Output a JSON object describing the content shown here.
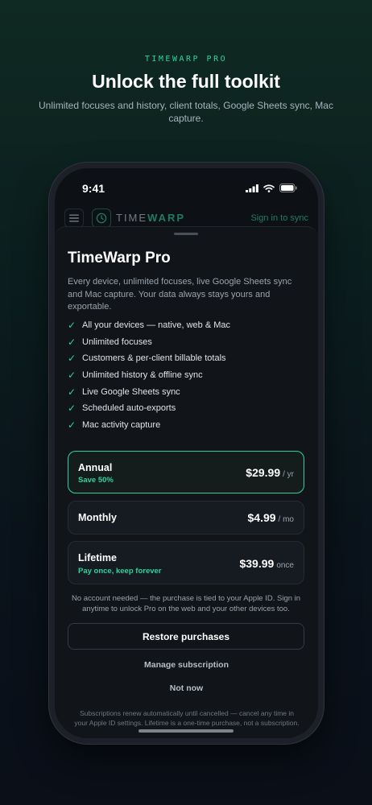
{
  "promo": {
    "eyebrow": "TIMEWARP PRO",
    "title": "Unlock the full toolkit",
    "subtitle": "Unlimited focuses and history, client totals, Google Sheets sync, Mac capture."
  },
  "status_bar": {
    "time": "9:41",
    "icons": [
      "signal-icon",
      "wifi-icon",
      "battery-icon"
    ]
  },
  "app_header": {
    "logo_time": "TIME",
    "logo_warp": "WARP",
    "signin": "Sign in to sync"
  },
  "sheet": {
    "title": "TimeWarp Pro",
    "description": "Every device, unlimited focuses, live Google Sheets sync and Mac capture. Your data always stays yours and exportable.",
    "features": [
      "All your devices — native, web & Mac",
      "Unlimited focuses",
      "Customers & per-client billable totals",
      "Unlimited history & offline sync",
      "Live Google Sheets sync",
      "Scheduled auto-exports",
      "Mac activity capture"
    ],
    "check_glyph": "✓",
    "plans": [
      {
        "name": "Annual",
        "badge": "Save 50%",
        "price": "$29.99",
        "period": "/ yr",
        "selected": true
      },
      {
        "name": "Monthly",
        "badge": "",
        "price": "$4.99",
        "period": "/ mo",
        "selected": false
      },
      {
        "name": "Lifetime",
        "badge": "Pay once, keep forever",
        "price": "$39.99",
        "period": "once",
        "selected": false
      }
    ],
    "note": "No account needed — the purchase is tied to your Apple ID. Sign in anytime to unlock Pro on the web and your other devices too.",
    "restore_label": "Restore purchases",
    "manage_label": "Manage subscription",
    "notnow_label": "Not now",
    "legal": "Subscriptions renew automatically until cancelled — cancel any time in your Apple ID settings. Lifetime is a one-time purchase, not a subscription."
  },
  "colors": {
    "accent": "#2fd39a",
    "sheet_bg": "#111419",
    "page_bg_top": "#0f2a22"
  }
}
